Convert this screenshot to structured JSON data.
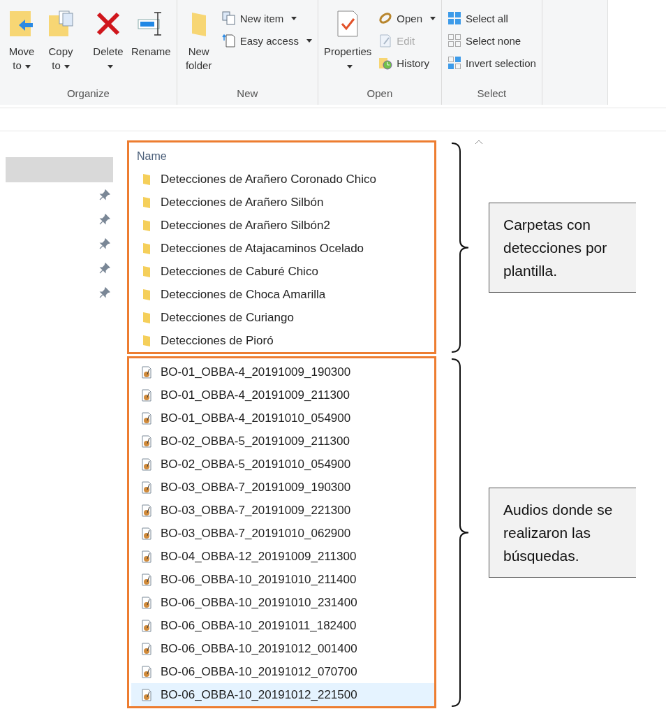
{
  "ribbon": {
    "groups": [
      {
        "label": "Organize",
        "large_buttons": [
          {
            "label": "Move to",
            "dropdown": true,
            "disabled": false
          },
          {
            "label": "Copy to",
            "dropdown": true,
            "disabled": false
          },
          {
            "label": "Delete",
            "dropdown": true,
            "disabled": false
          },
          {
            "label": "Rename",
            "dropdown": false,
            "disabled": false
          }
        ]
      },
      {
        "label": "New",
        "large_buttons": [
          {
            "label": "New folder",
            "dropdown": false,
            "disabled": false
          }
        ],
        "small_buttons": [
          {
            "label": "New item",
            "dropdown": true,
            "disabled": false
          },
          {
            "label": "Easy access",
            "dropdown": true,
            "disabled": false
          }
        ]
      },
      {
        "label": "Open",
        "large_buttons": [
          {
            "label": "Properties",
            "dropdown": true,
            "disabled": false
          }
        ],
        "small_buttons": [
          {
            "label": "Open",
            "dropdown": true,
            "disabled": false
          },
          {
            "label": "Edit",
            "dropdown": false,
            "disabled": true
          },
          {
            "label": "History",
            "dropdown": false,
            "disabled": false
          }
        ]
      },
      {
        "label": "Select",
        "small_buttons": [
          {
            "label": "Select all",
            "dropdown": false,
            "disabled": false
          },
          {
            "label": "Select none",
            "dropdown": false,
            "disabled": false
          },
          {
            "label": "Invert selection",
            "dropdown": false,
            "disabled": false
          }
        ]
      }
    ]
  },
  "sidebar": {
    "items": [
      {
        "selected": true,
        "pinned": false
      },
      {
        "selected": false,
        "pinned": true
      },
      {
        "selected": false,
        "pinned": true
      },
      {
        "selected": false,
        "pinned": true
      },
      {
        "selected": false,
        "pinned": true
      },
      {
        "selected": false,
        "pinned": true
      }
    ]
  },
  "file_list": {
    "column": "Name",
    "groups": [
      {
        "annotation": "Carpetas con detecciones por plantilla.",
        "items": [
          {
            "name": "Detecciones de Arañero Coronado Chico",
            "kind": "folder",
            "selected": false
          },
          {
            "name": "Detecciones de Arañero Silbón",
            "kind": "folder",
            "selected": false
          },
          {
            "name": "Detecciones de Arañero Silbón2",
            "kind": "folder",
            "selected": false
          },
          {
            "name": "Detecciones de Atajacaminos Ocelado",
            "kind": "folder",
            "selected": false
          },
          {
            "name": "Detecciones de Caburé Chico",
            "kind": "folder",
            "selected": false
          },
          {
            "name": "Detecciones de Choca Amarilla",
            "kind": "folder",
            "selected": false
          },
          {
            "name": "Detecciones de Curiango",
            "kind": "folder",
            "selected": false
          },
          {
            "name": "Detecciones de Pioró",
            "kind": "folder",
            "selected": false
          }
        ]
      },
      {
        "annotation": "Audios donde se realizaron las búsquedas.",
        "items": [
          {
            "name": "BO-01_OBBA-4_20191009_190300",
            "kind": "audio",
            "selected": false
          },
          {
            "name": "BO-01_OBBA-4_20191009_211300",
            "kind": "audio",
            "selected": false
          },
          {
            "name": "BO-01_OBBA-4_20191010_054900",
            "kind": "audio",
            "selected": false
          },
          {
            "name": "BO-02_OBBA-5_20191009_211300",
            "kind": "audio",
            "selected": false
          },
          {
            "name": "BO-02_OBBA-5_20191010_054900",
            "kind": "audio",
            "selected": false
          },
          {
            "name": "BO-03_OBBA-7_20191009_190300",
            "kind": "audio",
            "selected": false
          },
          {
            "name": "BO-03_OBBA-7_20191009_221300",
            "kind": "audio",
            "selected": false
          },
          {
            "name": "BO-03_OBBA-7_20191010_062900",
            "kind": "audio",
            "selected": false
          },
          {
            "name": "BO-04_OBBA-12_20191009_211300",
            "kind": "audio",
            "selected": false
          },
          {
            "name": "BO-06_OBBA-10_20191010_211400",
            "kind": "audio",
            "selected": false
          },
          {
            "name": "BO-06_OBBA-10_20191010_231400",
            "kind": "audio",
            "selected": false
          },
          {
            "name": "BO-06_OBBA-10_20191011_182400",
            "kind": "audio",
            "selected": false
          },
          {
            "name": "BO-06_OBBA-10_20191012_001400",
            "kind": "audio",
            "selected": false
          },
          {
            "name": "BO-06_OBBA-10_20191012_070700",
            "kind": "audio",
            "selected": false
          },
          {
            "name": "BO-06_OBBA-10_20191012_221500",
            "kind": "audio",
            "selected": true
          }
        ]
      }
    ]
  }
}
